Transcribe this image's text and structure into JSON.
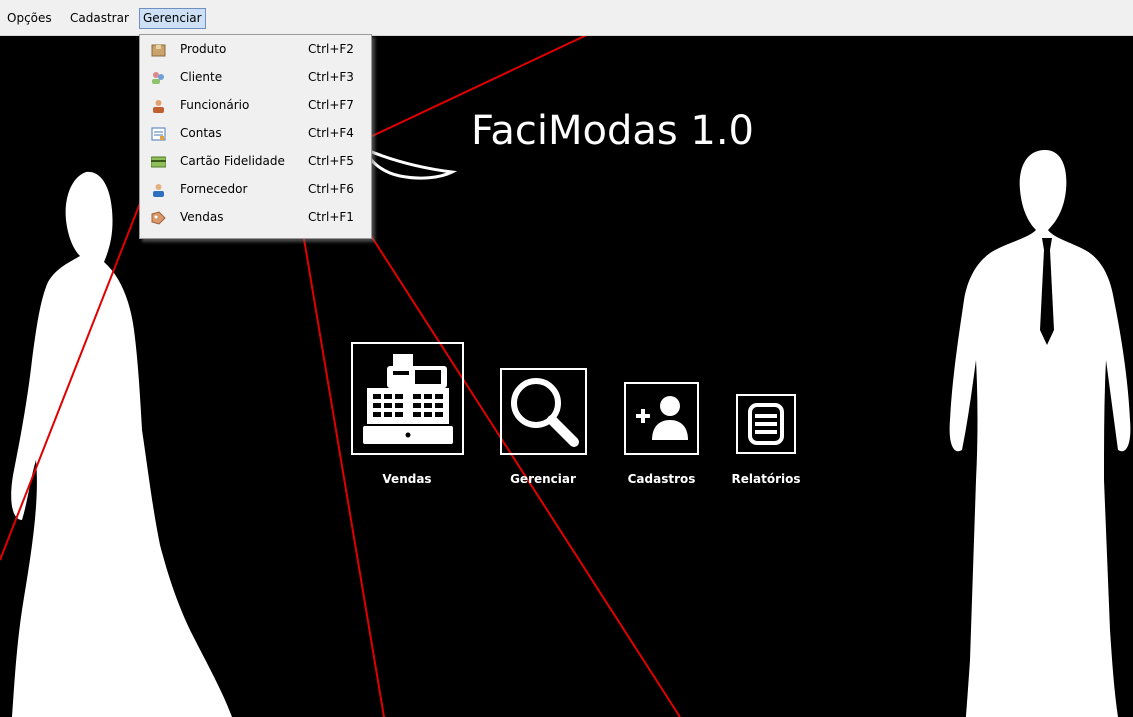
{
  "menubar": {
    "items": [
      "Opções",
      "Cadastrar",
      "Gerenciar"
    ]
  },
  "dropdown": {
    "items": [
      {
        "label": "Produto",
        "shortcut": "Ctrl+F2",
        "icon": "box-icon"
      },
      {
        "label": "Cliente",
        "shortcut": "Ctrl+F3",
        "icon": "people-icon"
      },
      {
        "label": "Funcionário",
        "shortcut": "Ctrl+F7",
        "icon": "person-icon"
      },
      {
        "label": "Contas",
        "shortcut": "Ctrl+F4",
        "icon": "ledger-icon"
      },
      {
        "label": "Cartão Fidelidade",
        "shortcut": "Ctrl+F5",
        "icon": "card-icon"
      },
      {
        "label": "Fornecedor",
        "shortcut": "Ctrl+F6",
        "icon": "supplier-icon"
      },
      {
        "label": "Vendas",
        "shortcut": "Ctrl+F1",
        "icon": "tag-icon"
      }
    ]
  },
  "app": {
    "title": "FaciModas 1.0"
  },
  "buttons": {
    "vendas": "Vendas",
    "gerenciar": "Gerenciar",
    "cadastros": "Cadastros",
    "relatorios": "Relatórios"
  },
  "colors": {
    "background": "#000000",
    "menubar": "#f0f0f0",
    "annotation_lines": "#e00000"
  }
}
